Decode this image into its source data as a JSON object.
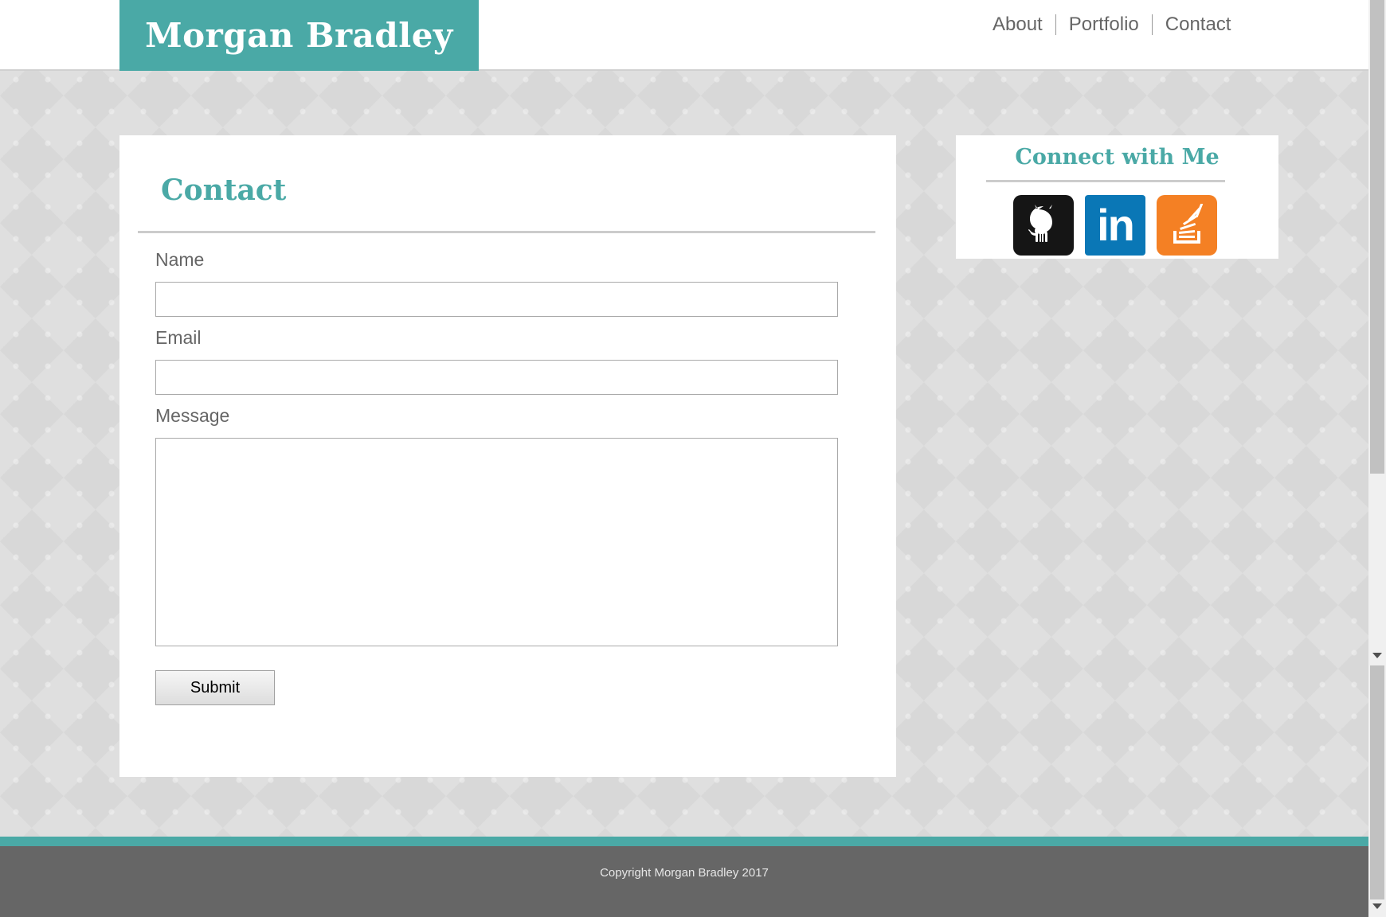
{
  "header": {
    "brand": "Morgan Bradley",
    "nav": [
      {
        "label": "About"
      },
      {
        "label": "Portfolio"
      },
      {
        "label": "Contact"
      }
    ]
  },
  "contact": {
    "title": "Contact",
    "fields": {
      "name_label": "Name",
      "name_value": "",
      "email_label": "Email",
      "email_value": "",
      "message_label": "Message",
      "message_value": ""
    },
    "submit_label": "Submit"
  },
  "sidebar": {
    "title": "Connect with Me",
    "social": [
      {
        "icon": "github-icon",
        "color": "#151515"
      },
      {
        "icon": "linkedin-icon",
        "color": "#0a77b6",
        "text": "in"
      },
      {
        "icon": "stackoverflow-icon",
        "color": "#f48024"
      }
    ]
  },
  "footer": {
    "copyright": "Copyright Morgan Bradley 2017"
  },
  "colors": {
    "accent": "#4aa9a6",
    "footer_bg": "#666666",
    "nav_text": "#666666"
  }
}
